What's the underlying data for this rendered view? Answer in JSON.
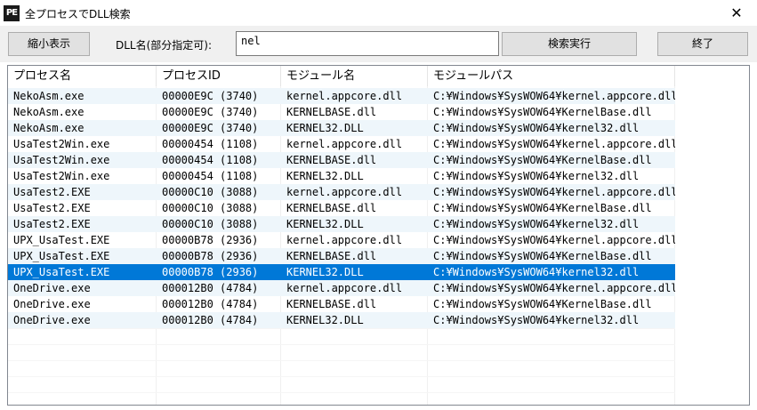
{
  "window": {
    "icon_text": "PE",
    "title": "全プロセスでDLL検索",
    "close_glyph": "✕"
  },
  "toolbar": {
    "shrink_label": "縮小表示",
    "dll_label": "DLL名(部分指定可):",
    "search_value": "nel",
    "search_button": "検索実行",
    "exit_button": "終了"
  },
  "table": {
    "columns": [
      "プロセス名",
      "プロセスID",
      "モジュール名",
      "モジュールパス"
    ],
    "rows": [
      [
        "NekoAsm.exe",
        "00000E9C (3740)",
        "kernel.appcore.dll",
        "C:¥Windows¥SysWOW64¥kernel.appcore.dll"
      ],
      [
        "NekoAsm.exe",
        "00000E9C (3740)",
        "KERNELBASE.dll",
        "C:¥Windows¥SysWOW64¥KernelBase.dll"
      ],
      [
        "NekoAsm.exe",
        "00000E9C (3740)",
        "KERNEL32.DLL",
        "C:¥Windows¥SysWOW64¥kernel32.dll"
      ],
      [
        "UsaTest2Win.exe",
        "00000454 (1108)",
        "kernel.appcore.dll",
        "C:¥Windows¥SysWOW64¥kernel.appcore.dll"
      ],
      [
        "UsaTest2Win.exe",
        "00000454 (1108)",
        "KERNELBASE.dll",
        "C:¥Windows¥SysWOW64¥KernelBase.dll"
      ],
      [
        "UsaTest2Win.exe",
        "00000454 (1108)",
        "KERNEL32.DLL",
        "C:¥Windows¥SysWOW64¥kernel32.dll"
      ],
      [
        "UsaTest2.EXE",
        "00000C10 (3088)",
        "kernel.appcore.dll",
        "C:¥Windows¥SysWOW64¥kernel.appcore.dll"
      ],
      [
        "UsaTest2.EXE",
        "00000C10 (3088)",
        "KERNELBASE.dll",
        "C:¥Windows¥SysWOW64¥KernelBase.dll"
      ],
      [
        "UsaTest2.EXE",
        "00000C10 (3088)",
        "KERNEL32.DLL",
        "C:¥Windows¥SysWOW64¥kernel32.dll"
      ],
      [
        "UPX_UsaTest.EXE",
        "00000B78 (2936)",
        "kernel.appcore.dll",
        "C:¥Windows¥SysWOW64¥kernel.appcore.dll"
      ],
      [
        "UPX_UsaTest.EXE",
        "00000B78 (2936)",
        "KERNELBASE.dll",
        "C:¥Windows¥SysWOW64¥KernelBase.dll"
      ],
      [
        "UPX_UsaTest.EXE",
        "00000B78 (2936)",
        "KERNEL32.DLL",
        "C:¥Windows¥SysWOW64¥kernel32.dll"
      ],
      [
        "OneDrive.exe",
        "000012B0 (4784)",
        "kernel.appcore.dll",
        "C:¥Windows¥SysWOW64¥kernel.appcore.dll"
      ],
      [
        "OneDrive.exe",
        "000012B0 (4784)",
        "KERNELBASE.dll",
        "C:¥Windows¥SysWOW64¥KernelBase.dll"
      ],
      [
        "OneDrive.exe",
        "000012B0 (4784)",
        "KERNEL32.DLL",
        "C:¥Windows¥SysWOW64¥kernel32.dll"
      ]
    ],
    "selected_row": 11
  },
  "colors": {
    "selection": "#0078d7",
    "alt_row": "#eef6fb"
  }
}
